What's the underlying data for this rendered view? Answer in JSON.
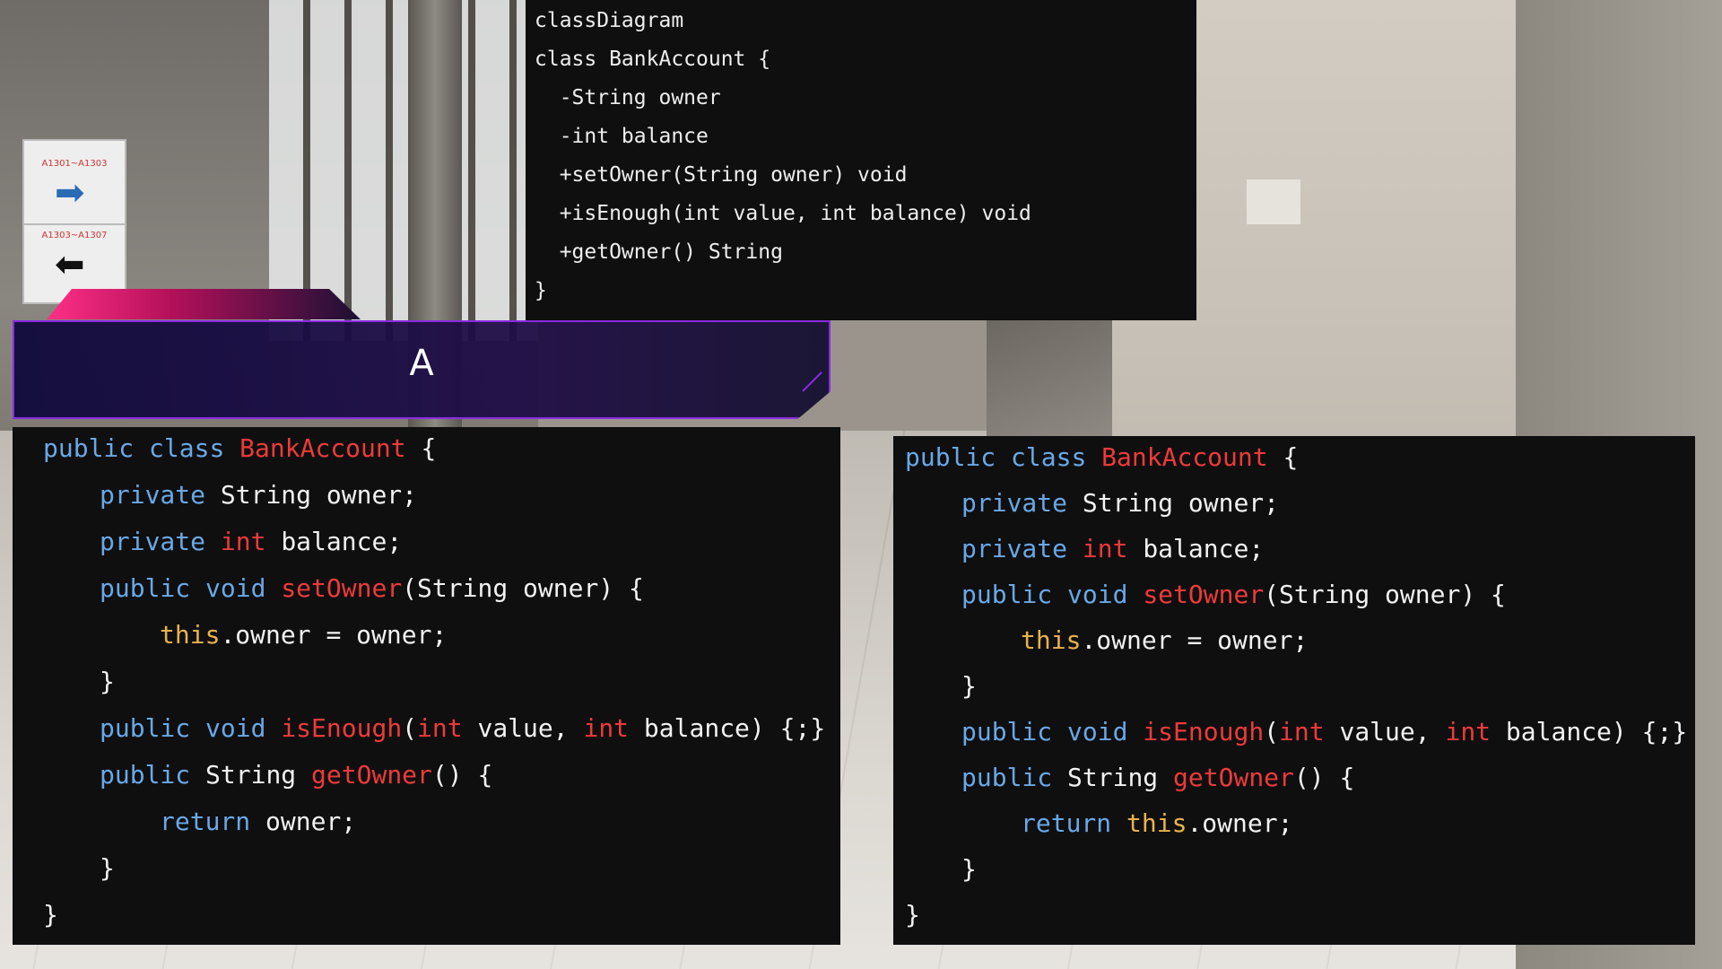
{
  "background": {
    "sign_text_top": "A1301~A1303",
    "sign_text_bottom": "A1303~A1307",
    "sign_arrow_top_icon": "right-arrow-icon",
    "sign_arrow_bottom_icon": "left-arrow-icon"
  },
  "uml": {
    "lines": [
      "classDiagram",
      "class BankAccount {",
      "  -String owner",
      "  -int balance",
      "  +setOwner(String owner) void",
      "  +isEnough(int value, int balance) void",
      "  +getOwner() String",
      "}"
    ]
  },
  "option_a": {
    "label": "A",
    "tokens": {
      "l0": [
        "public",
        "class",
        "BankAccount",
        "{"
      ],
      "l1": [
        "private",
        "String owner;"
      ],
      "l2": [
        "private",
        "int",
        "balance;"
      ],
      "l3": [
        "public",
        "void",
        "setOwner",
        "(String owner) {"
      ],
      "l4": [
        "this",
        ".owner = owner;"
      ],
      "l5": [
        "}"
      ],
      "l6": [
        "public",
        "void",
        "isEnough",
        "(",
        "int",
        " value, ",
        "int",
        " balance) {;}"
      ],
      "l7": [
        "public",
        "String",
        "getOwner",
        "() {"
      ],
      "l8": [
        "return",
        "owner;"
      ],
      "l9": [
        "}"
      ],
      "l10": [
        "}"
      ]
    }
  },
  "option_b": {
    "tokens": {
      "l0": [
        "public",
        "class",
        "BankAccount",
        "{"
      ],
      "l1": [
        "private",
        "String owner;"
      ],
      "l2": [
        "private",
        "int",
        "balance;"
      ],
      "l3": [
        "public",
        "void",
        "setOwner",
        "(String owner) {"
      ],
      "l4": [
        "this",
        ".owner = owner;"
      ],
      "l5": [
        "}"
      ],
      "l6": [
        "public",
        "void",
        "isEnough",
        "(",
        "int",
        " value, ",
        "int",
        " balance) {;}"
      ],
      "l7": [
        "public",
        "String",
        "getOwner",
        "() {"
      ],
      "l8": [
        "return",
        "this",
        ".owner;"
      ],
      "l9": [
        "}"
      ],
      "l10": [
        "}"
      ]
    }
  },
  "colors": {
    "keyword": "#6aa8e6",
    "identifier": "#ee3a3a",
    "this": "#e8b24d",
    "plain": "#f2f2f2",
    "panel_bg": "#0f0f10",
    "banner_border": "#8a2be2"
  }
}
